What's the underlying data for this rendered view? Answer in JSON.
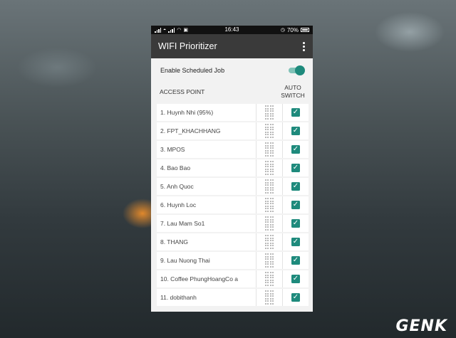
{
  "status_bar": {
    "time": "16:43",
    "battery": "70%"
  },
  "app_bar": {
    "title": "WIFI Prioritizer",
    "menu_icon": "more-vert-icon"
  },
  "schedule": {
    "label": "Enable Scheduled Job",
    "enabled": true
  },
  "list_header": {
    "access_point": "ACCESS POINT",
    "auto_switch_line1": "AUTO",
    "auto_switch_line2": "SWITCH"
  },
  "access_points": [
    {
      "name": "1. Huynh Nhi (95%)",
      "auto_switch": true
    },
    {
      "name": "2. FPT_KHACHHANG",
      "auto_switch": true
    },
    {
      "name": "3. MPOS",
      "auto_switch": true
    },
    {
      "name": "4. Bao Bao",
      "auto_switch": true
    },
    {
      "name": "5. Anh Quoc",
      "auto_switch": true
    },
    {
      "name": "6. Huynh Loc",
      "auto_switch": true
    },
    {
      "name": "7. Lau Mam So1",
      "auto_switch": true
    },
    {
      "name": "8. THANG",
      "auto_switch": true
    },
    {
      "name": "9. Lau Nuong Thai",
      "auto_switch": true
    },
    {
      "name": "10. Coffee PhungHoangCo a",
      "auto_switch": true
    },
    {
      "name": "11. dobithanh",
      "auto_switch": true
    }
  ],
  "colors": {
    "accent": "#1e8a7c",
    "app_bar": "#3a3a3a",
    "background": "#f2f2f2"
  },
  "watermark": "GENK"
}
